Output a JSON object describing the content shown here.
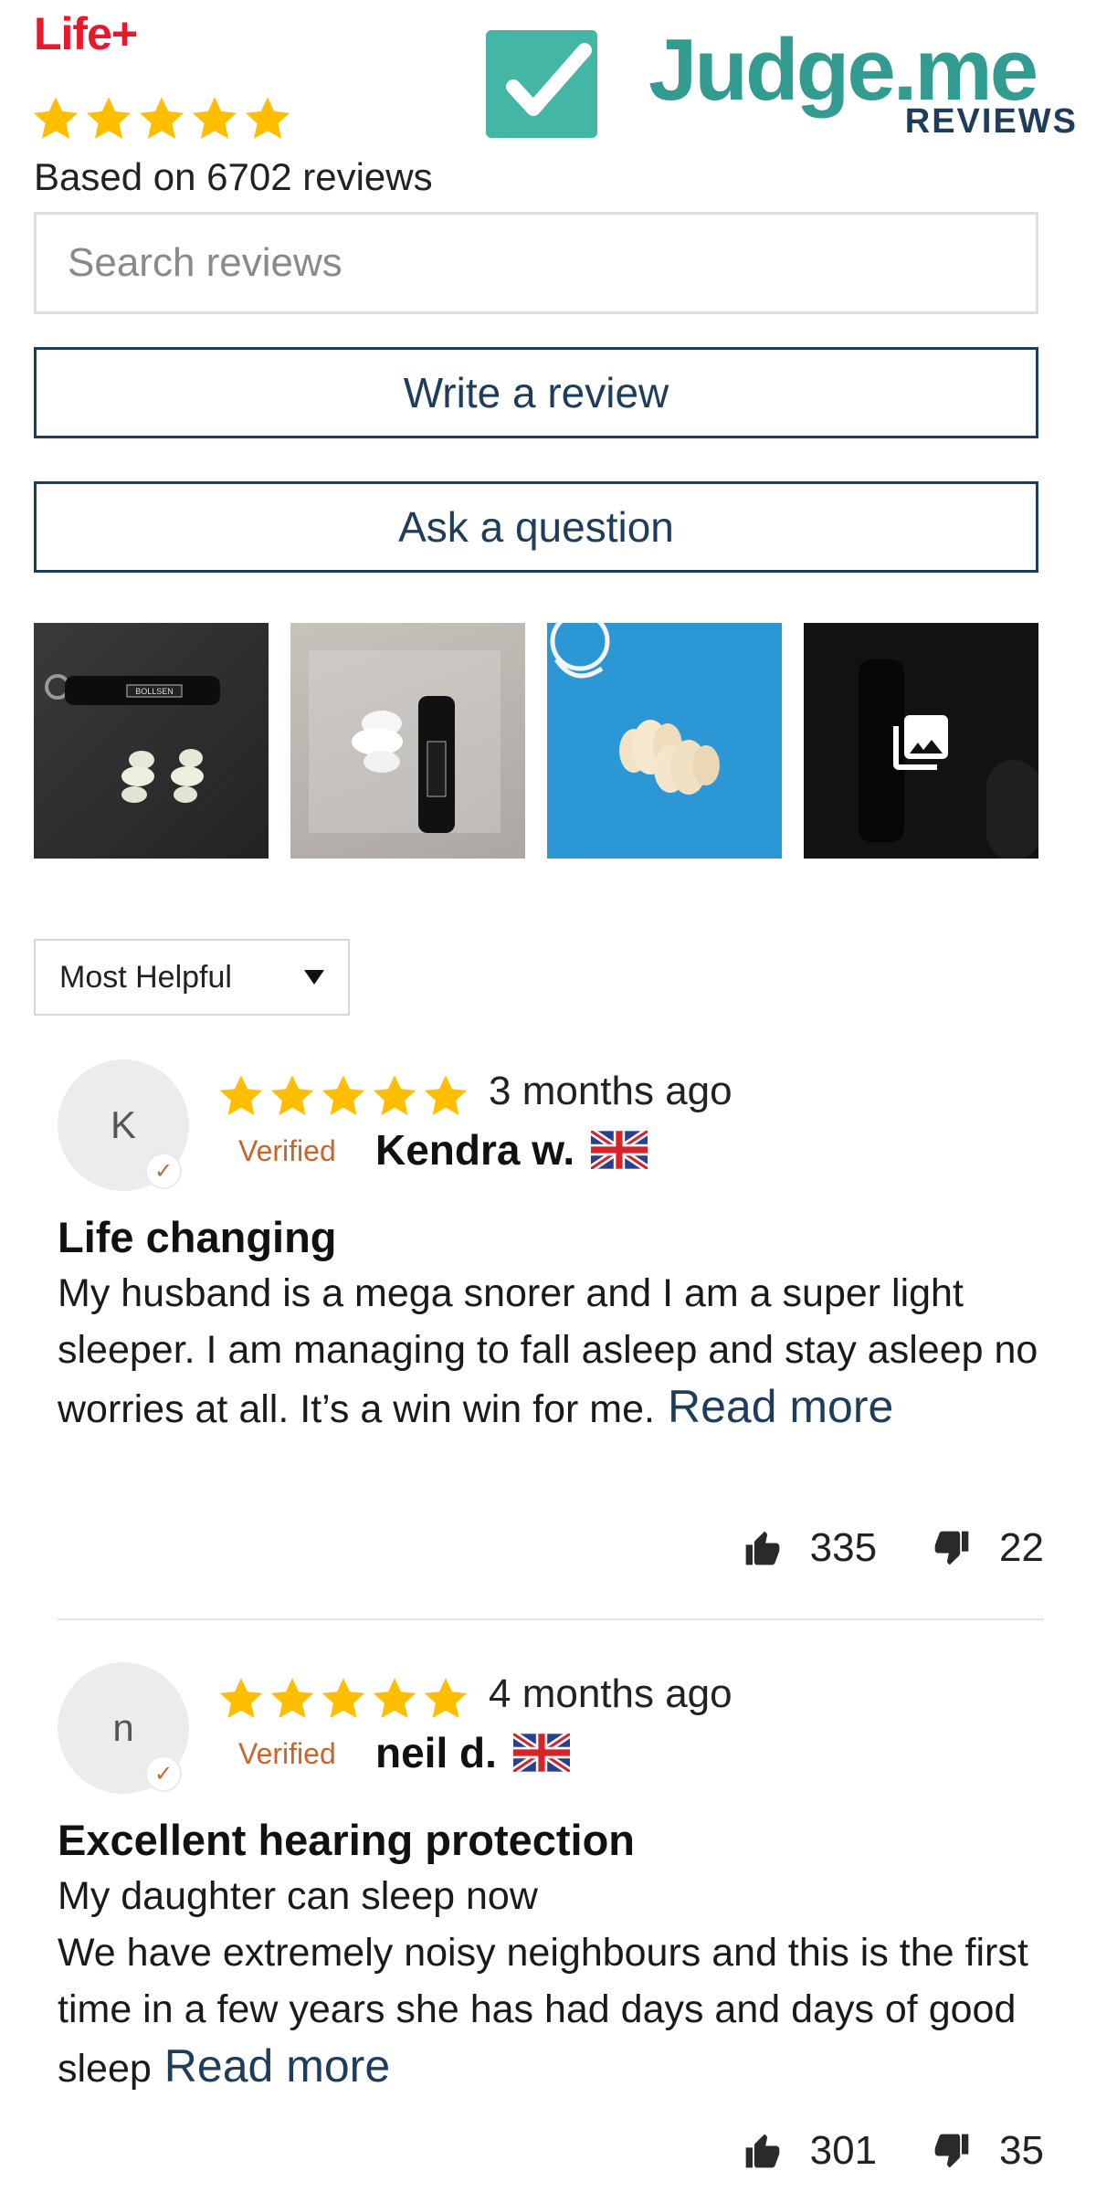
{
  "header": {
    "brand": "Life+",
    "logo_word": "Judge.me",
    "logo_sub": "REVIEWS",
    "rating_stars": 5,
    "based_on": "Based on 6702 reviews"
  },
  "search": {
    "placeholder": "Search reviews"
  },
  "actions": {
    "write_review": "Write a review",
    "ask_question": "Ask a question"
  },
  "media": {
    "thumbnails": [
      "earplugs-case-photo",
      "earplugs-bag-photo",
      "earplugs-blue-photo",
      "case-photo"
    ],
    "more_icon": "gallery-icon"
  },
  "sort": {
    "selected": "Most Helpful"
  },
  "reviews": [
    {
      "initial": "K",
      "stars": 5,
      "date": "3 months ago",
      "verified": "Verified",
      "name": "Kendra w.",
      "flag": "uk-flag-icon",
      "title": "Life changing",
      "body": "My husband is a mega snorer and I am a super light sleeper. I am managing to fall asleep and stay asleep no worries at all. It’s a win win for me.",
      "read_more": "Read more",
      "upvotes": "335",
      "downvotes": "22"
    },
    {
      "initial": "n",
      "stars": 5,
      "date": "4 months ago",
      "verified": "Verified",
      "name": "neil d.",
      "flag": "uk-flag-icon",
      "title": "Excellent hearing protection",
      "body_line1": "My daughter can sleep now",
      "body": "We have extremely noisy neighbours and this is the first time in a few years she has had days and days of good sleep",
      "read_more": "Read more",
      "upvotes": "301",
      "downvotes": "35"
    }
  ],
  "colors": {
    "brand": "#e8192c",
    "star": "#ffbe00",
    "judgeme": "#339c90",
    "primary": "#1d3d5a",
    "verified": "#c7652a"
  }
}
